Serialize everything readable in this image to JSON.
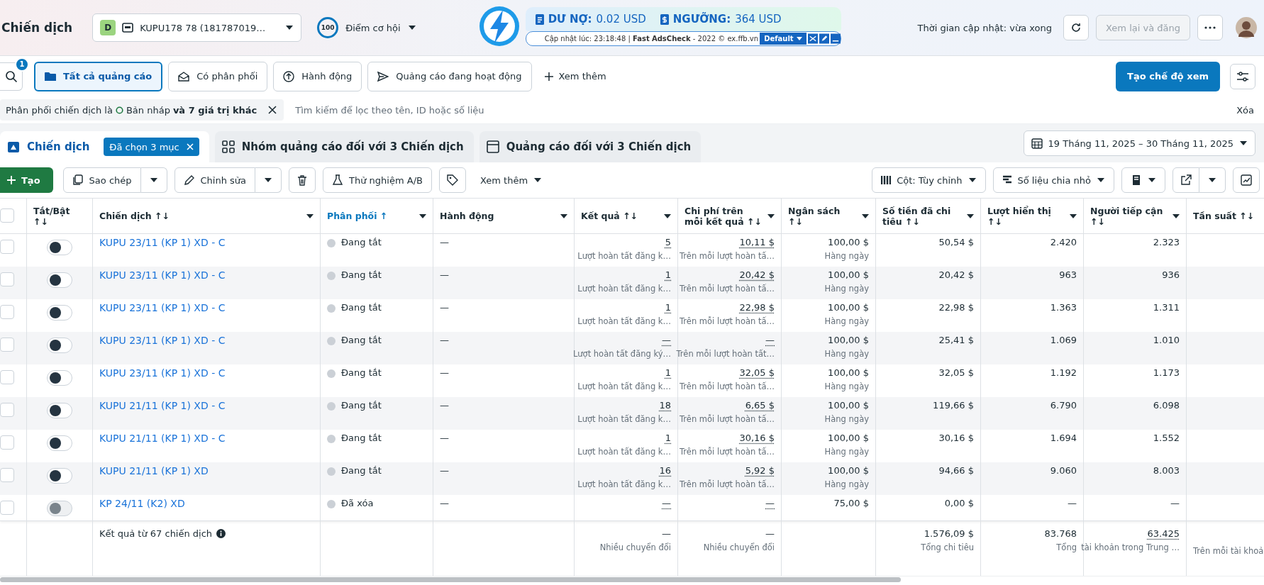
{
  "header": {
    "title": "Chiến dịch",
    "account": {
      "initial": "D",
      "name": "KUPU178 78 (181787019…"
    },
    "score": {
      "value": "100",
      "label": "Điểm cơ hội"
    },
    "extension": {
      "debt_label": "DƯ NỢ:",
      "debt": "0.02 USD",
      "threshold_label": "NGƯỠNG:",
      "threshold": "364 USD",
      "credit": "Cập nhật lúc: 23:18:48 | **Fast** **AdsCheck** - 2022 © ex.ffb.vn",
      "profile": "Default"
    },
    "update_time": "Thời gian cập nhật: vừa xong",
    "review_button": {
      "label": "Xem lại và đăng",
      "disabled": true
    }
  },
  "views": {
    "search_badge": "1",
    "tabs": [
      {
        "label": "Tất cả quảng cáo",
        "selected": true
      },
      {
        "label": "Có phân phối",
        "selected": false
      },
      {
        "label": "Hành động",
        "selected": false
      },
      {
        "label": "Quảng cáo đang hoạt động",
        "selected": false
      }
    ],
    "more": "Xem thêm",
    "create_view": "Tạo chế độ xem"
  },
  "filter": {
    "prefix": "Phân phối chiến dịch là",
    "value": "Bản nháp",
    "suffix": "và 7 giá trị khác",
    "placeholder": "Tìm kiếm để lọc theo tên, ID hoặc số liệu",
    "clear": "Xóa"
  },
  "levels": {
    "tabs": [
      {
        "label": "Chiến dịch",
        "selected": true,
        "badge": "Đã chọn 3 mục"
      },
      {
        "label": "Nhóm quảng cáo đối với 3 Chiến dịch",
        "selected": false
      },
      {
        "label": "Quảng cáo đối với 3 Chiến dịch",
        "selected": false
      }
    ],
    "date_range": "19 Tháng 11, 2025 – 30 Tháng 11, 2025"
  },
  "toolbar": {
    "create": "Tạo",
    "copy": "Sao chép",
    "edit": "Chỉnh sửa",
    "ab_test": "Thử nghiệm A/B",
    "more": "Xem thêm",
    "columns": "Cột: Tùy chỉnh",
    "breakdown": "Số liệu chia nhỏ"
  },
  "table": {
    "select_all": {
      "checked": false
    },
    "columns": [
      {
        "label": "Tắt/Bật",
        "sort": "↑↓",
        "sorted": false,
        "menu": false
      },
      {
        "label": "Chiến dịch",
        "sort": "↑↓",
        "sorted": false,
        "menu": true
      },
      {
        "label": "Phân phối",
        "sort": "↑",
        "sorted": true,
        "menu": true
      },
      {
        "label": "Hành động",
        "sorted": false,
        "menu": true
      },
      {
        "label": "Kết quả",
        "sort": "↑↓",
        "sorted": false,
        "menu": true
      },
      {
        "label": "Chi phí trên mỗi kết quả",
        "sort": "↑↓",
        "sorted": false,
        "menu": true
      },
      {
        "label": "Ngân sách",
        "sort": "↑↓",
        "sorted": false,
        "menu": true
      },
      {
        "label": "Số tiền đã chi tiêu",
        "sort": "↑↓",
        "sorted": false,
        "menu": true
      },
      {
        "label": "Lượt hiển thị",
        "sort": "↑↓",
        "sorted": false,
        "menu": true
      },
      {
        "label": "Người tiếp cận",
        "sort": "↑↓",
        "sorted": false,
        "menu": true
      },
      {
        "label": "Tần suất",
        "sort": "↑↓",
        "sorted": false,
        "menu": false
      }
    ],
    "rows": [
      {
        "checked": false,
        "on": false,
        "disabled": false,
        "name": "KUPU 23/11 (KP 1) XD - C",
        "status": "Đang tắt",
        "action": "—",
        "result": "5",
        "result_sub": "Lượt hoàn tất đăng k…",
        "cost": "10,11 $",
        "cost_sub": "Trên mỗi lượt hoàn tấ…",
        "budget": "100,00 $",
        "budget_sub": "Hàng ngày",
        "spent": "50,54 $",
        "impressions": "2.420",
        "reach": "2.323"
      },
      {
        "checked": false,
        "on": false,
        "disabled": false,
        "name": "KUPU 23/11 (KP 1) XD - C",
        "status": "Đang tắt",
        "action": "—",
        "result": "1",
        "result_sub": "Lượt hoàn tất đăng k…",
        "cost": "20,42 $",
        "cost_sub": "Trên mỗi lượt hoàn tấ…",
        "budget": "100,00 $",
        "budget_sub": "Hàng ngày",
        "spent": "20,42 $",
        "impressions": "963",
        "reach": "936"
      },
      {
        "checked": false,
        "on": false,
        "disabled": false,
        "name": "KUPU 23/11 (KP 1) XD - C",
        "status": "Đang tắt",
        "action": "—",
        "result": "1",
        "result_sub": "Lượt hoàn tất đăng k…",
        "cost": "22,98 $",
        "cost_sub": "Trên mỗi lượt hoàn tấ…",
        "budget": "100,00 $",
        "budget_sub": "Hàng ngày",
        "spent": "22,98 $",
        "impressions": "1.363",
        "reach": "1.311"
      },
      {
        "checked": false,
        "on": false,
        "disabled": false,
        "name": "KUPU 23/11 (KP 1) XD - C",
        "status": "Đang tắt",
        "action": "—",
        "result": "—",
        "result_sub": "Lượt hoàn tất đăng ký…",
        "cost": "—",
        "cost_sub": "Trên mỗi lượt hoàn tất…",
        "budget": "100,00 $",
        "budget_sub": "Hàng ngày",
        "spent": "25,41 $",
        "impressions": "1.069",
        "reach": "1.010"
      },
      {
        "checked": false,
        "on": false,
        "disabled": false,
        "name": "KUPU 23/11 (KP 1) XD - C",
        "status": "Đang tắt",
        "action": "—",
        "result": "1",
        "result_sub": "Lượt hoàn tất đăng k…",
        "cost": "32,05 $",
        "cost_sub": "Trên mỗi lượt hoàn tấ…",
        "budget": "100,00 $",
        "budget_sub": "Hàng ngày",
        "spent": "32,05 $",
        "impressions": "1.192",
        "reach": "1.173"
      },
      {
        "checked": false,
        "on": false,
        "disabled": false,
        "name": "KUPU 21/11 (KP 1) XD - C",
        "status": "Đang tắt",
        "action": "—",
        "result": "18",
        "result_sub": "Lượt hoàn tất đăng k…",
        "cost": "6,65 $",
        "cost_sub": "Trên mỗi lượt hoàn tấ…",
        "budget": "100,00 $",
        "budget_sub": "Hàng ngày",
        "spent": "119,66 $",
        "impressions": "6.790",
        "reach": "6.098"
      },
      {
        "checked": false,
        "on": false,
        "disabled": false,
        "name": "KUPU 21/11 (KP 1) XD - C",
        "status": "Đang tắt",
        "action": "—",
        "result": "1",
        "result_sub": "Lượt hoàn tất đăng k…",
        "cost": "30,16 $",
        "cost_sub": "Trên mỗi lượt hoàn tấ…",
        "budget": "100,00 $",
        "budget_sub": "Hàng ngày",
        "spent": "30,16 $",
        "impressions": "1.694",
        "reach": "1.552"
      },
      {
        "checked": false,
        "on": false,
        "disabled": false,
        "name": "KUPU 21/11 (KP 1) XD",
        "status": "Đang tắt",
        "action": "—",
        "result": "16",
        "result_sub": "Lượt hoàn tất đăng k…",
        "cost": "5,92 $",
        "cost_sub": "Trên mỗi lượt hoàn tấ…",
        "budget": "100,00 $",
        "budget_sub": "Hàng ngày",
        "spent": "94,66 $",
        "impressions": "9.060",
        "reach": "8.003"
      },
      {
        "checked": false,
        "on": false,
        "disabled": true,
        "name": "KP 24/11 (K2) XD",
        "status": "Đã xóa",
        "action": "—",
        "result": "—",
        "cost": "—",
        "budget": "75,00 $",
        "spent": "0,00 $",
        "impressions": "—",
        "reach": "—"
      }
    ],
    "footer": {
      "label": "Kết quả từ 67 chiến dịch",
      "result": "—",
      "result_sub": "Nhiều chuyển đổi",
      "cost": "—",
      "cost_sub": "Nhiều chuyển đổi",
      "spent": "1.576,09 $",
      "spent_sub": "Tổng chi tiêu",
      "impressions": "83.768",
      "impressions_sub": "Tổng",
      "reach": "63.425",
      "reach_sub": "tài khoản trong Trung …",
      "frequency_sub": "Trên mỗi tài khoả"
    }
  }
}
